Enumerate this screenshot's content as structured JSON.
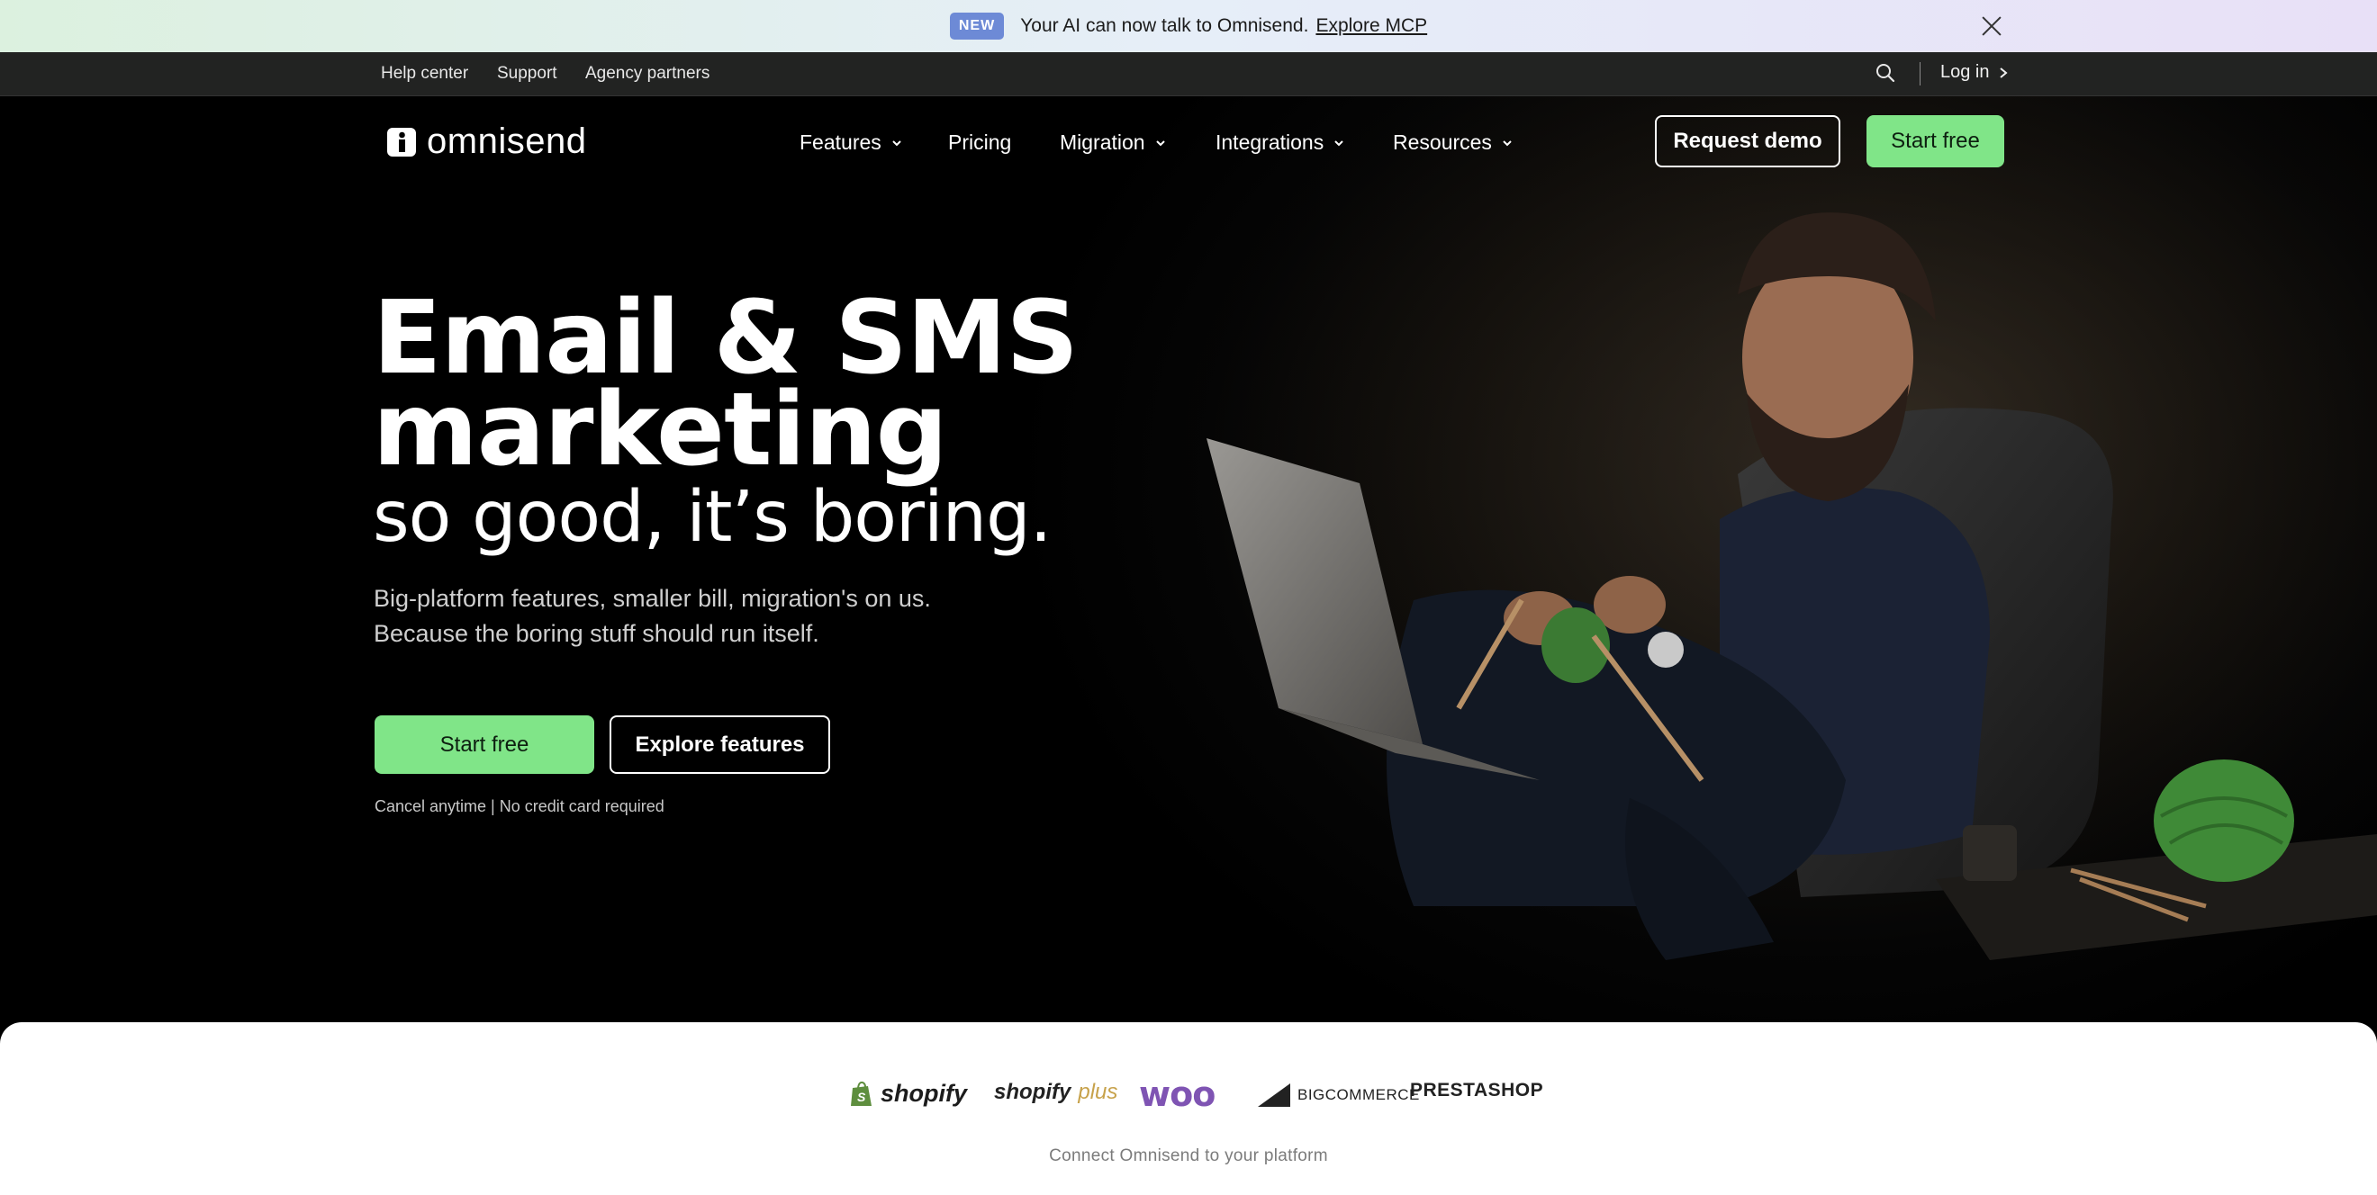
{
  "announcement": {
    "badge": "NEW",
    "message": "Your AI can now talk to Omnisend.",
    "link": "Explore MCP"
  },
  "utility": {
    "items": [
      "Help center",
      "Support",
      "Agency partners"
    ],
    "login": "Log in"
  },
  "nav": {
    "brand": "omnisend",
    "menu": [
      {
        "label": "Features",
        "dropdown": true
      },
      {
        "label": "Pricing",
        "dropdown": false
      },
      {
        "label": "Migration",
        "dropdown": true
      },
      {
        "label": "Integrations",
        "dropdown": true
      },
      {
        "label": "Resources",
        "dropdown": true
      }
    ],
    "request_demo": "Request demo",
    "start_free": "Start free"
  },
  "hero": {
    "headline_line1": "Email & SMS",
    "headline_line2": "marketing",
    "tagline": "so good, it’s boring.",
    "sub_line1": "Big-platform features, smaller bill, migration's on us.",
    "sub_line2": "Because the boring stuff should run itself.",
    "cta_primary": "Start free",
    "cta_secondary": "Explore features",
    "fine_print": "Cancel anytime | No credit card required"
  },
  "platforms": {
    "logos": [
      "shopify",
      "shopify",
      "plus",
      "woo",
      "BIGCOMMERCE",
      "PRESTASHOP"
    ],
    "caption": "Connect Omnisend to your platform"
  },
  "colors": {
    "accent_green": "#80e588",
    "badge_blue": "#6d8ad6",
    "woo_purple": "#7f54b3"
  }
}
